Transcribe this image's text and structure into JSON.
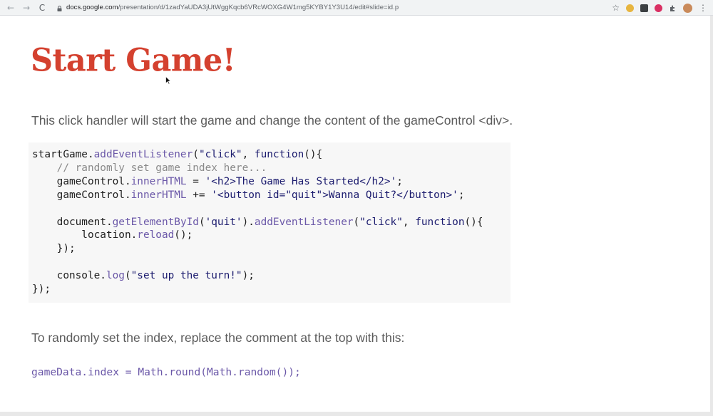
{
  "browser": {
    "url_host": "docs.google.com",
    "url_path": "/presentation/d/1zadYaUDA3jUtWggKqcb6VRcWOXG4W1mg5KYBY1Y3U14/edit#slide=id.p",
    "nav_back_glyph": "←",
    "nav_forward_glyph": "→",
    "reload_glyph": "C",
    "star_glyph": "☆",
    "menu_glyph": "⋮",
    "extension_colors": [
      "#e7b53f",
      "#3c4043",
      "#d93063",
      "#5f6368"
    ],
    "avatar_color": "#c98a5a"
  },
  "slide": {
    "title": "Start Game!",
    "title_color": "#d4412f",
    "intro_text": "This click handler will start the game and change the content of the gameControl <div>.",
    "code_block": {
      "lines": [
        [
          {
            "t": "startGame."
          },
          {
            "t": "addEventListener",
            "c": "prop"
          },
          {
            "t": "("
          },
          {
            "t": "\"click\"",
            "c": "str"
          },
          {
            "t": ", "
          },
          {
            "t": "function",
            "c": "kw"
          },
          {
            "t": "(){"
          }
        ],
        [
          {
            "t": "    "
          },
          {
            "t": "// randomly set game index here...",
            "c": "com"
          }
        ],
        [
          {
            "t": "    gameControl."
          },
          {
            "t": "innerHTML",
            "c": "prop"
          },
          {
            "t": " = "
          },
          {
            "t": "'<h2>The Game Has Started</h2>'",
            "c": "str"
          },
          {
            "t": ";"
          }
        ],
        [
          {
            "t": "    gameControl."
          },
          {
            "t": "innerHTML",
            "c": "prop"
          },
          {
            "t": " += "
          },
          {
            "t": "'<button id=\"quit\">Wanna Quit?</button>'",
            "c": "str"
          },
          {
            "t": ";"
          }
        ],
        [
          {
            "t": ""
          }
        ],
        [
          {
            "t": "    document."
          },
          {
            "t": "getElementById",
            "c": "prop"
          },
          {
            "t": "("
          },
          {
            "t": "'quit'",
            "c": "str"
          },
          {
            "t": ")."
          },
          {
            "t": "addEventListener",
            "c": "prop"
          },
          {
            "t": "("
          },
          {
            "t": "\"click\"",
            "c": "str"
          },
          {
            "t": ", "
          },
          {
            "t": "function",
            "c": "kw"
          },
          {
            "t": "(){"
          }
        ],
        [
          {
            "t": "        location."
          },
          {
            "t": "reload",
            "c": "prop"
          },
          {
            "t": "();"
          }
        ],
        [
          {
            "t": "    });"
          }
        ],
        [
          {
            "t": ""
          }
        ],
        [
          {
            "t": "    console."
          },
          {
            "t": "log",
            "c": "prop"
          },
          {
            "t": "("
          },
          {
            "t": "\"set up the turn!\"",
            "c": "str"
          },
          {
            "t": ");"
          }
        ],
        [
          {
            "t": "});"
          }
        ]
      ]
    },
    "outro_text": "To randomly set the index, replace the comment at the top with this:",
    "code_line": "gameData.index = Math.round(Math.random());"
  }
}
